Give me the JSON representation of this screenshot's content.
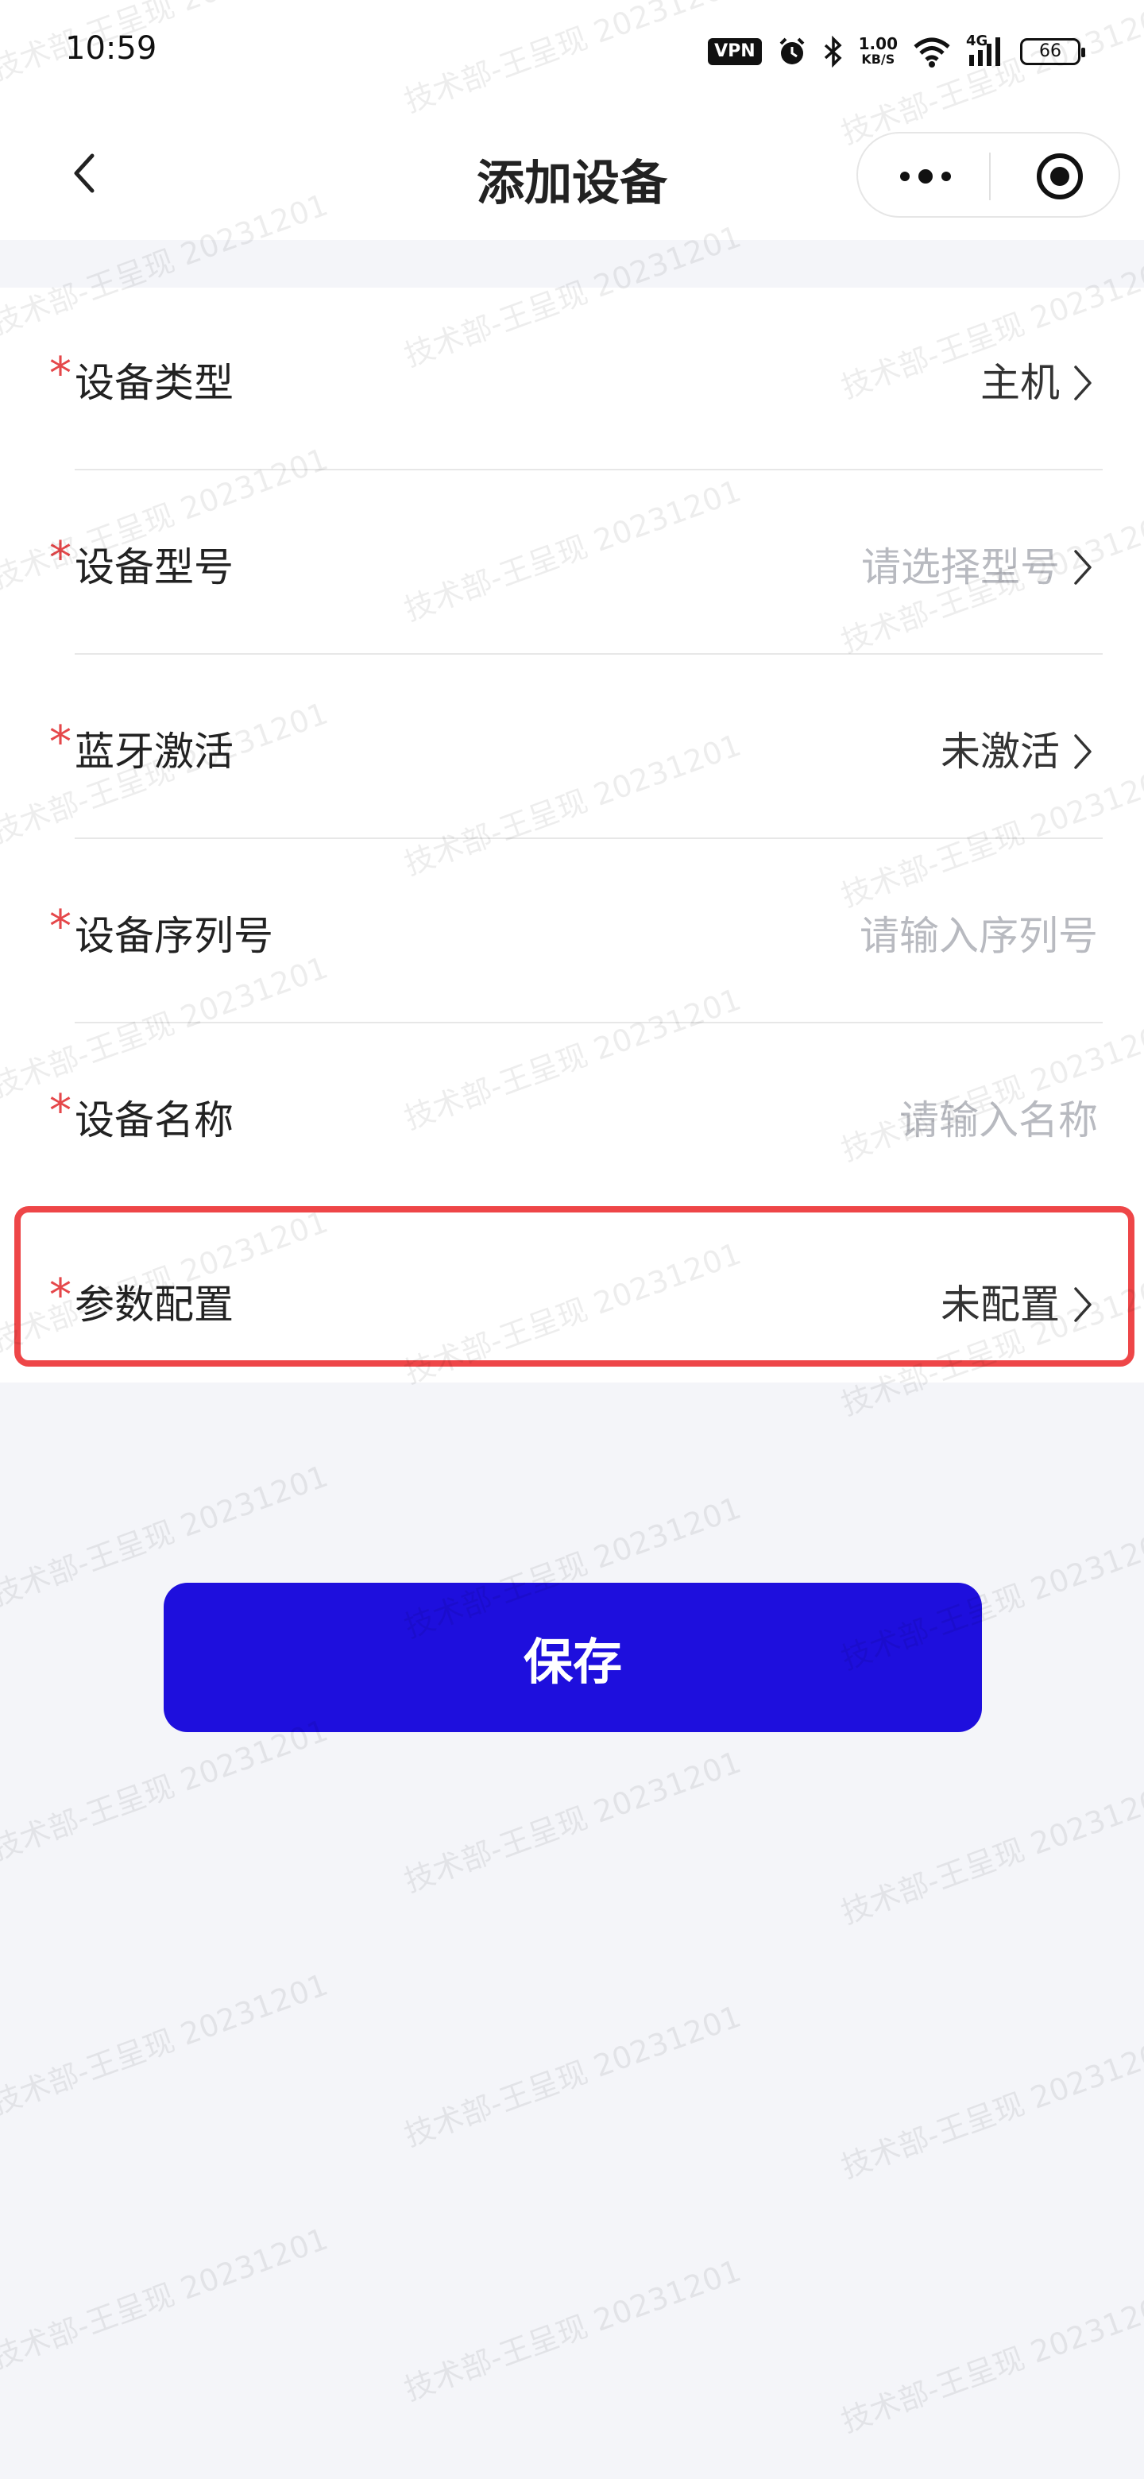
{
  "status_bar": {
    "time": "10:59",
    "vpn": "VPN",
    "speed_value": "1.00",
    "speed_unit": "KB/S",
    "network": "4G",
    "battery": "66",
    "icons": [
      "alarm-icon",
      "bluetooth-icon",
      "wifi-icon",
      "signal-icon"
    ]
  },
  "nav": {
    "title": "添加设备",
    "back_icon": "chevron-left-icon",
    "more_icon": "more-dots-icon",
    "target_icon": "target-circle-icon"
  },
  "form": {
    "required_mark": "*",
    "rows": [
      {
        "label": "设备类型",
        "value": "主机",
        "is_placeholder": false,
        "has_chevron": true
      },
      {
        "label": "设备型号",
        "value": "请选择型号",
        "is_placeholder": true,
        "has_chevron": true
      },
      {
        "label": "蓝牙激活",
        "value": "未激活",
        "is_placeholder": false,
        "has_chevron": true
      },
      {
        "label": "设备序列号",
        "value": "请输入序列号",
        "is_placeholder": true,
        "has_chevron": false
      },
      {
        "label": "设备名称",
        "value": "请输入名称",
        "is_placeholder": true,
        "has_chevron": false
      },
      {
        "label": "参数配置",
        "value": "未配置",
        "is_placeholder": false,
        "has_chevron": true
      }
    ]
  },
  "save_button": {
    "label": "保存"
  },
  "watermark": "技术部-王呈现 20231201",
  "colors": {
    "accent": "#1e0fdd",
    "required": "#e5474a",
    "highlight": "#ee4648",
    "placeholder": "#b8bac0",
    "background": "#f4f5f9"
  }
}
